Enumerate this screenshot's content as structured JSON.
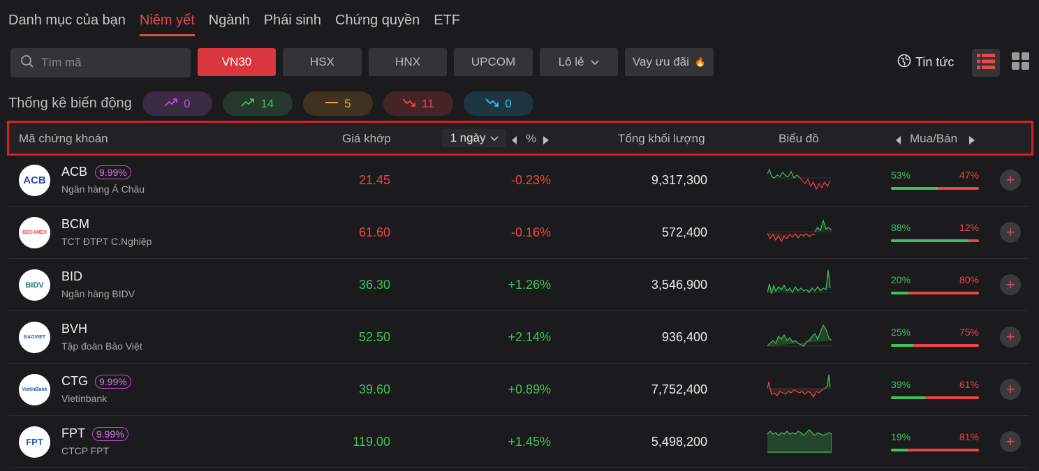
{
  "tabs": [
    "Danh mục của bạn",
    "Niêm yết",
    "Ngành",
    "Phái sinh",
    "Chứng quyền",
    "ETF"
  ],
  "search": {
    "placeholder": "Tìm mã"
  },
  "markets": [
    "VN30",
    "HSX",
    "HNX",
    "UPCOM"
  ],
  "odd_lot": "Lô lẻ",
  "loan": "Vay ưu đãi",
  "loan_emoji": "🔥",
  "news": "Tin tức",
  "stats": {
    "label": "Thống kê biến động",
    "ceiling": "0",
    "up": "14",
    "ref": "5",
    "down": "11",
    "floor": "0"
  },
  "header": {
    "symbol": "Mã chứng khoán",
    "price": "Giá khớp",
    "period": "1 ngày",
    "pct": "%",
    "volume": "Tổng khối lượng",
    "chart": "Biểu đồ",
    "buysell": "Mua/Bán"
  },
  "colors": {
    "up": "#3fc25c",
    "down": "#ef4444",
    "accent": "#e5484d",
    "ceiling": "#c44ad6",
    "floor": "#38bdf8",
    "ref": "#f5a623"
  },
  "rows": [
    {
      "symbol": "ACB",
      "badge": "9.99%",
      "name": "Ngân hàng Á Châu",
      "price": "21.45",
      "change": "-0.23%",
      "volume": "9,317,300",
      "buy": "53%",
      "sell": "47%",
      "buy_frac": 0.53,
      "dir": "down",
      "logo_text": "ACB"
    },
    {
      "symbol": "BCM",
      "badge": "",
      "name": "TCT ĐTPT C.Nghiệp",
      "price": "61.60",
      "change": "-0.16%",
      "volume": "572,400",
      "buy": "88%",
      "sell": "12%",
      "buy_frac": 0.88,
      "dir": "down",
      "logo_text": "BECAMEX"
    },
    {
      "symbol": "BID",
      "badge": "",
      "name": "Ngân hàng BIDV",
      "price": "36.30",
      "change": "+1.26%",
      "volume": "3,546,900",
      "buy": "20%",
      "sell": "80%",
      "buy_frac": 0.2,
      "dir": "up",
      "logo_text": "BIDV"
    },
    {
      "symbol": "BVH",
      "badge": "",
      "name": "Tập đoàn Bảo Việt",
      "price": "52.50",
      "change": "+2.14%",
      "volume": "936,400",
      "buy": "25%",
      "sell": "75%",
      "buy_frac": 0.25,
      "dir": "up",
      "logo_text": "BAOVIET"
    },
    {
      "symbol": "CTG",
      "badge": "9.99%",
      "name": "Vietinbank",
      "price": "39.60",
      "change": "+0.89%",
      "volume": "7,752,400",
      "buy": "39%",
      "sell": "61%",
      "buy_frac": 0.39,
      "dir": "up",
      "logo_text": "VietinBank"
    },
    {
      "symbol": "FPT",
      "badge": "9.99%",
      "name": "CTCP FPT",
      "price": "119.00",
      "change": "+1.45%",
      "volume": "5,498,200",
      "buy": "19%",
      "sell": "81%",
      "buy_frac": 0.19,
      "dir": "up",
      "logo_text": "FPT"
    }
  ]
}
